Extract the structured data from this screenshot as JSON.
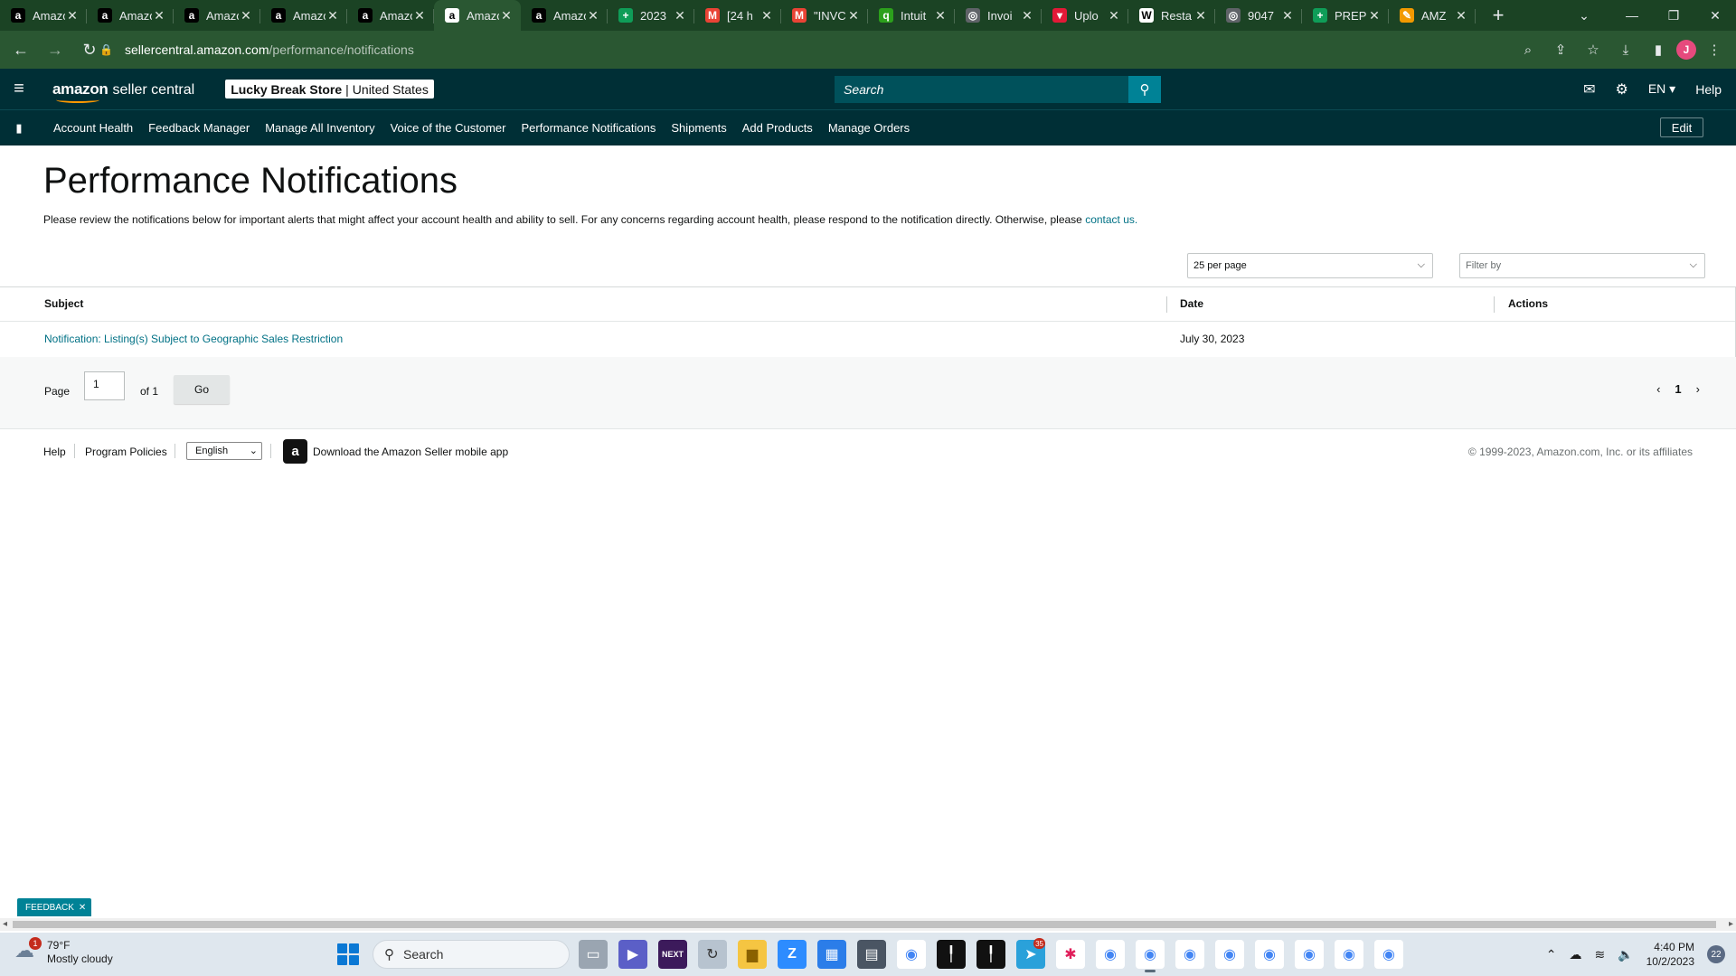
{
  "browser": {
    "tabs": [
      {
        "title": "Amazon",
        "favicon": "a",
        "favicon_color": "#000000",
        "active": false
      },
      {
        "title": "Amazon",
        "favicon": "a",
        "favicon_color": "#000000",
        "active": false
      },
      {
        "title": "Amazon",
        "favicon": "a",
        "favicon_color": "#000000",
        "active": false
      },
      {
        "title": "Amazon",
        "favicon": "a",
        "favicon_color": "#000000",
        "active": false
      },
      {
        "title": "Amazon",
        "favicon": "a",
        "favicon_color": "#000000",
        "active": false
      },
      {
        "title": "Amazon",
        "favicon": "a",
        "favicon_color": "#ffffff",
        "active": true
      },
      {
        "title": "Amazon",
        "favicon": "a",
        "favicon_color": "#000000",
        "active": false
      },
      {
        "title": "2023",
        "favicon": "+",
        "favicon_color": "#0f9d58",
        "active": false
      },
      {
        "title": "[24 h",
        "favicon": "M",
        "favicon_color": "#ea4335",
        "active": false
      },
      {
        "title": "\"INVC",
        "favicon": "M",
        "favicon_color": "#ea4335",
        "active": false
      },
      {
        "title": "Intuit",
        "favicon": "q",
        "favicon_color": "#2ca01c",
        "active": false
      },
      {
        "title": "Invoi",
        "favicon": "◎",
        "favicon_color": "#5f6368",
        "active": false
      },
      {
        "title": "Uplo",
        "favicon": "▾",
        "favicon_color": "#e31937",
        "active": false
      },
      {
        "title": "Resta",
        "favicon": "W",
        "favicon_color": "#ffffff",
        "active": false
      },
      {
        "title": "9047",
        "favicon": "◎",
        "favicon_color": "#5f6368",
        "active": false
      },
      {
        "title": "PREP",
        "favicon": "+",
        "favicon_color": "#0f9d58",
        "active": false
      },
      {
        "title": "AMZ",
        "favicon": "✎",
        "favicon_color": "#f29900",
        "active": false
      }
    ],
    "url_host": "sellercentral.amazon.com",
    "url_path": "/performance/notifications",
    "profile_initial": "J"
  },
  "header": {
    "logo_brand": "amazon",
    "logo_product": "seller central",
    "store_name": "Lucky Break Store",
    "store_separator": "|",
    "store_region": "United States",
    "search_placeholder": "Search",
    "language": "EN",
    "help": "Help"
  },
  "nav": {
    "items": [
      "Account Health",
      "Feedback Manager",
      "Manage All Inventory",
      "Voice of the Customer",
      "Performance Notifications",
      "Shipments",
      "Add Products",
      "Manage Orders"
    ],
    "edit_label": "Edit"
  },
  "main": {
    "title": "Performance Notifications",
    "intro_text": "Please review the notifications below for important alerts that might affect your account health and ability to sell. For any concerns regarding account health, please respond to the notification directly. Otherwise, please ",
    "intro_link": "contact us.",
    "per_page": "25 per page",
    "filter_placeholder": "Filter by",
    "columns": {
      "subject": "Subject",
      "date": "Date",
      "actions": "Actions"
    },
    "rows": [
      {
        "subject": "Notification: Listing(s) Subject to Geographic Sales Restriction",
        "date": "July 30, 2023"
      }
    ],
    "pager": {
      "page_label": "Page",
      "page_value": "1",
      "of_label": "of 1",
      "go_label": "Go",
      "current": "1"
    }
  },
  "footer": {
    "help": "Help",
    "program_policies": "Program Policies",
    "language": "English",
    "app_text": "Download the Amazon Seller mobile app",
    "copyright": "© 1999-2023, Amazon.com, Inc. or its affiliates"
  },
  "feedback": {
    "label": "FEEDBACK"
  },
  "taskbar": {
    "weather_temp": "79°F",
    "weather_desc": "Mostly cloudy",
    "weather_badge": "1",
    "search_label": "Search",
    "telegram_badge": "35",
    "time": "4:40 PM",
    "date": "10/2/2023",
    "notifications": "22"
  }
}
